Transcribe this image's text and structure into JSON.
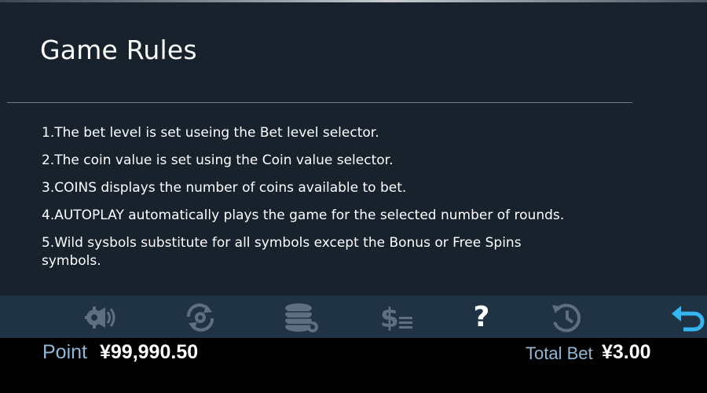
{
  "title": "Game Rules",
  "rules": [
    "1.The bet level is set useing the Bet level selector.",
    "2.The coin value is set using the Coin value selector.",
    "3.COINS displays the number of coins available to bet.",
    "4.AUTOPLAY automatically plays the game for the selected number of rounds.",
    "5.Wild sysbols substitute for all symbols except the Bonus or Free Spins symbols."
  ],
  "toolbar": {
    "icons": [
      "sound-settings-icon",
      "autoplay-settings-icon",
      "coin-settings-icon",
      "paytable-icon",
      "help-icon",
      "history-icon",
      "back-icon"
    ],
    "help_glyph": "?",
    "colors": {
      "muted": "#5e6f7f",
      "active": "#ffffff",
      "back": "#36b6f0"
    }
  },
  "footer": {
    "point_label": "Point",
    "point_value": "¥99,990.50",
    "bet_label": "Total Bet",
    "bet_value": "¥3.00"
  },
  "colors": {
    "background": "#17222d",
    "toolbar": "#1f3345",
    "footer": "#000000",
    "label_blue": "#8fb7d6"
  }
}
